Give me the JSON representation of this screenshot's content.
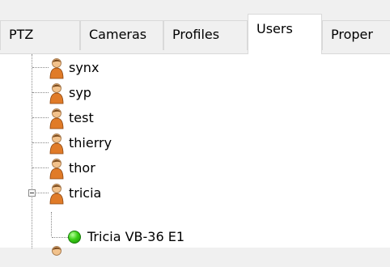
{
  "tabs": [
    {
      "label": "PTZ",
      "active": false
    },
    {
      "label": "Cameras",
      "active": false
    },
    {
      "label": "Profiles",
      "active": false
    },
    {
      "label": "Users",
      "active": true
    },
    {
      "label": "Proper",
      "active": false
    }
  ],
  "tree": {
    "users": [
      {
        "name": "synx"
      },
      {
        "name": "syp"
      },
      {
        "name": "test"
      },
      {
        "name": "thierry"
      },
      {
        "name": "thor"
      },
      {
        "name": "tricia",
        "expanded": true
      }
    ],
    "devices": [
      {
        "name": "Tricia VB-36 E1",
        "status_color": "#2fbf12"
      }
    ]
  },
  "colors": {
    "tree_line": "#8a8a8a",
    "tab_border": "#d9d9d9",
    "status_online": "#2fbf12"
  },
  "icons": {
    "user": "user-person-icon",
    "device_status": "status-online-icon",
    "expander": "collapse-minus-icon"
  }
}
